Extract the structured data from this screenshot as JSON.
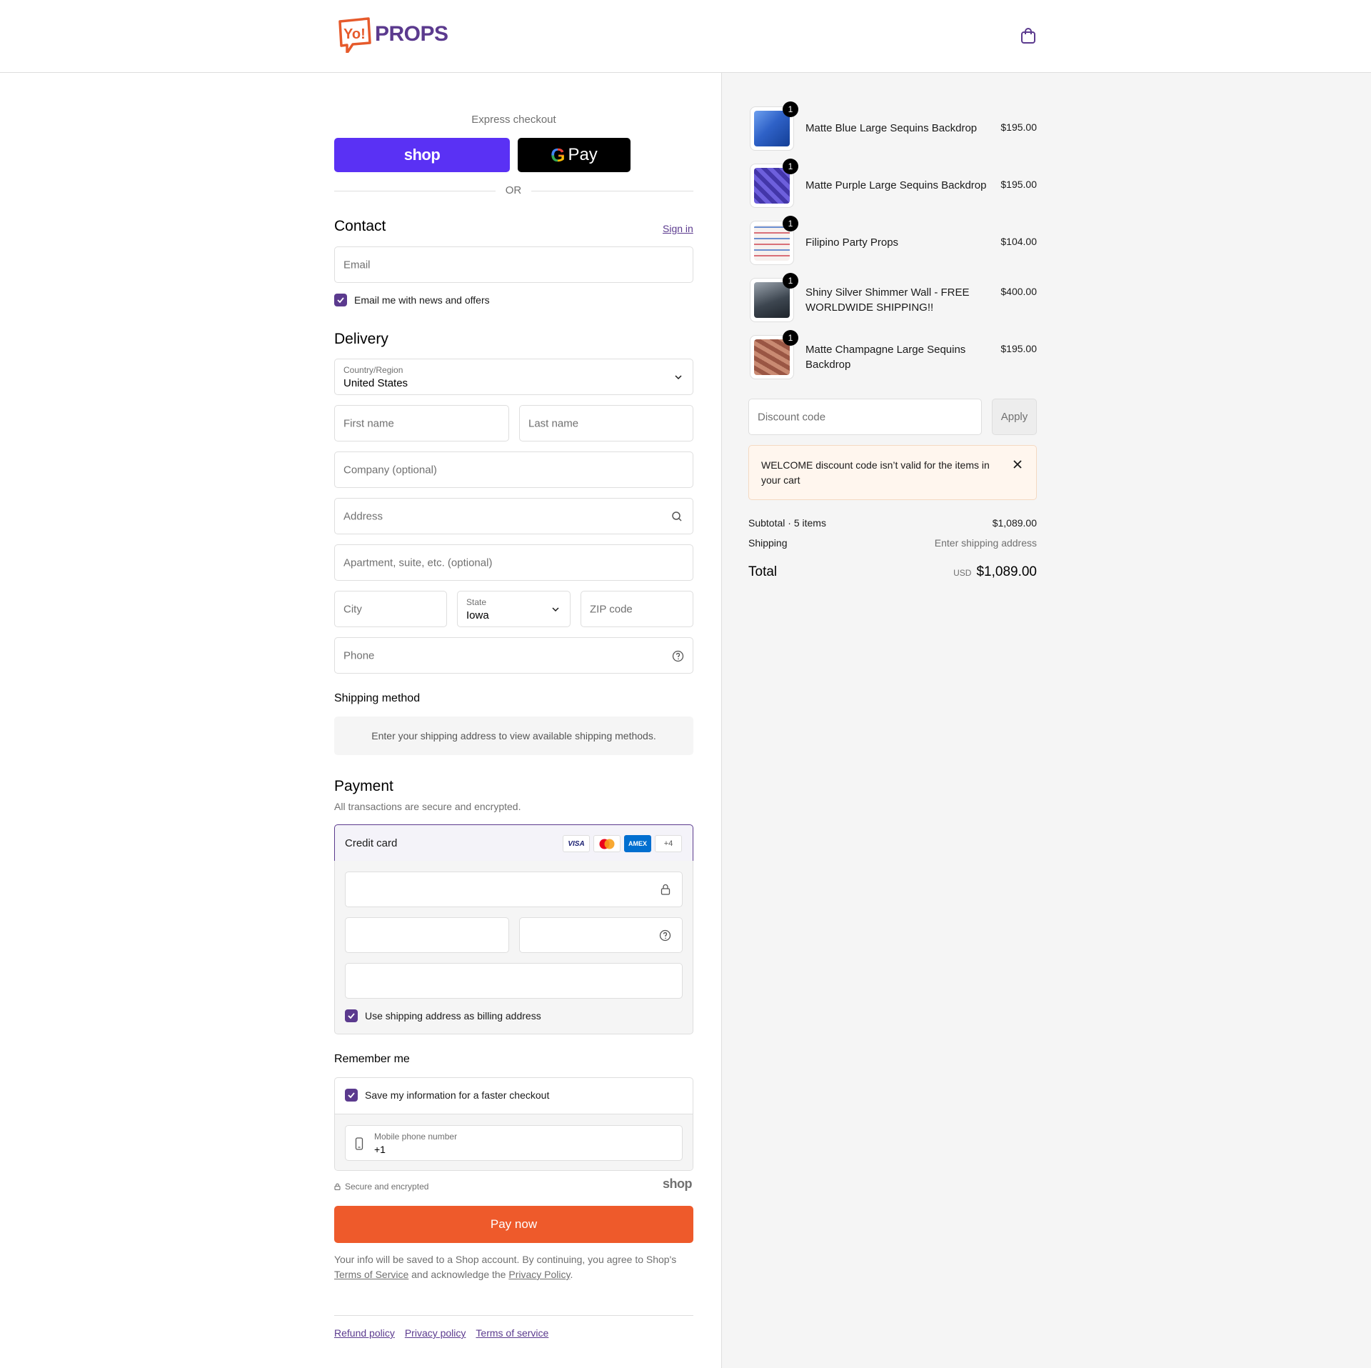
{
  "header": {
    "logo_badge": "Yo!",
    "logo_text": "PROPS"
  },
  "express": {
    "label": "Express checkout",
    "shop_label": "shop",
    "gpay_g": "G",
    "gpay_label": "Pay",
    "or": "OR"
  },
  "contact": {
    "title": "Contact",
    "sign_in": "Sign in",
    "email_placeholder": "Email",
    "newsletter_label": "Email me with news and offers"
  },
  "delivery": {
    "title": "Delivery",
    "country_label": "Country/Region",
    "country_value": "United States",
    "first_name": "First name",
    "last_name": "Last name",
    "company": "Company (optional)",
    "address": "Address",
    "apartment": "Apartment, suite, etc. (optional)",
    "city": "City",
    "state_label": "State",
    "state_value": "Iowa",
    "zip": "ZIP code",
    "phone": "Phone"
  },
  "shipping_method": {
    "title": "Shipping method",
    "message": "Enter your shipping address to view available shipping methods."
  },
  "payment": {
    "title": "Payment",
    "subtitle": "All transactions are secure and encrypted.",
    "credit_card": "Credit card",
    "cards": [
      "VISA",
      "MC",
      "AMEX"
    ],
    "more_cards": "+4",
    "billing_label": "Use shipping address as billing address"
  },
  "remember": {
    "title": "Remember me",
    "save_label": "Save my information for a faster checkout",
    "mobile_label": "Mobile phone number",
    "mobile_value": "+1",
    "secure_label": "Secure and encrypted",
    "shop_brand": "shop"
  },
  "pay_now": "Pay now",
  "legal": {
    "text1": "Your info will be saved to a Shop account. By continuing, you agree to Shop's",
    "terms": "Terms of Service",
    "text2": "and acknowledge the",
    "privacy": "Privacy Policy",
    "text3": "."
  },
  "footer_links": [
    "Refund policy",
    "Privacy policy",
    "Terms of service"
  ],
  "cart": {
    "items": [
      {
        "name": "Matte Blue Large Sequins Backdrop",
        "price": "$195.00",
        "qty": "1",
        "color": "#2f62c8"
      },
      {
        "name": "Matte Purple Large Sequins Backdrop",
        "price": "$195.00",
        "qty": "1",
        "color": "#5a4cc6"
      },
      {
        "name": "Filipino Party Props",
        "price": "$104.00",
        "qty": "1",
        "color": "#f1e8e4"
      },
      {
        "name": "Shiny Silver Shimmer Wall - FREE WORLDWIDE SHIPPING!!",
        "price": "$400.00",
        "qty": "1",
        "color": "#6d7278"
      },
      {
        "name": "Matte Champagne Large Sequins Backdrop",
        "price": "$195.00",
        "qty": "1",
        "color": "#b4715c"
      }
    ],
    "discount_placeholder": "Discount code",
    "apply": "Apply",
    "error": "WELCOME discount code isn’t valid for the items in your cart",
    "subtotal_label": "Subtotal · 5 items",
    "subtotal_value": "$1,089.00",
    "shipping_label": "Shipping",
    "shipping_value": "Enter shipping address",
    "total_label": "Total",
    "currency": "USD",
    "total_value": "$1,089.00"
  },
  "colors": {
    "accent": "#5b3a8e",
    "pay_button": "#ee5a2b",
    "shop_pay": "#5a31f4"
  }
}
